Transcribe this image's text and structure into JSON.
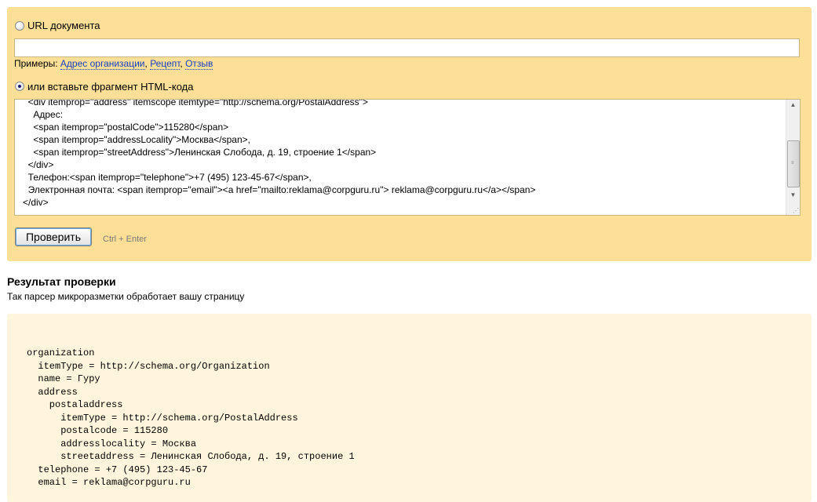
{
  "url_option": {
    "label": "URL документа",
    "selected": false,
    "value": ""
  },
  "examples": {
    "prefix": "Примеры: ",
    "links": [
      "Адрес организации",
      "Рецепт",
      "Отзыв"
    ],
    "separator": ", "
  },
  "html_option": {
    "label": "или вставьте фрагмент HTML-кода",
    "selected": true
  },
  "code_lines": [
    "  <div itemprop=\"address\" itemscope itemtype=\"http://schema.org/PostalAddress\">",
    "    Адрес:",
    "    <span itemprop=\"postalCode\">115280</span>",
    "    <span itemprop=\"addressLocality\">Москва</span>,",
    "    <span itemprop=\"streetAddress\">Ленинская Слобода, д. 19, строение 1</span>",
    "  </div>",
    "  Телефон:<span itemprop=\"telephone\">+7 (495) 123-45-67</span>,",
    "  Электронная почта: <span itemprop=\"email\"><a href=\"mailto:reklama@corpguru.ru\"> reklama@corpguru.ru</a></span>",
    "</div>"
  ],
  "check_button": "Проверить",
  "shortcut_hint": "Ctrl + Enter",
  "result": {
    "title": "Результат проверки",
    "subtitle": "Так парсер микроразметки обработает вашу страницу",
    "lines": [
      "organization",
      "  itemType = http://schema.org/Organization",
      "  name = Гуру",
      "  address",
      "    postaladdress",
      "      itemType = http://schema.org/PostalAddress",
      "      postalcode = 115280",
      "      addresslocality = Москва",
      "      streetaddress = Ленинская Слобода, д. 19, строение 1",
      "  telephone = +7 (495) 123-45-67",
      "  email = reklama@corpguru.ru"
    ]
  },
  "colors": {
    "form_panel": "#fedf97",
    "result_panel": "#fef5dc",
    "link": "#1a3dc1"
  }
}
